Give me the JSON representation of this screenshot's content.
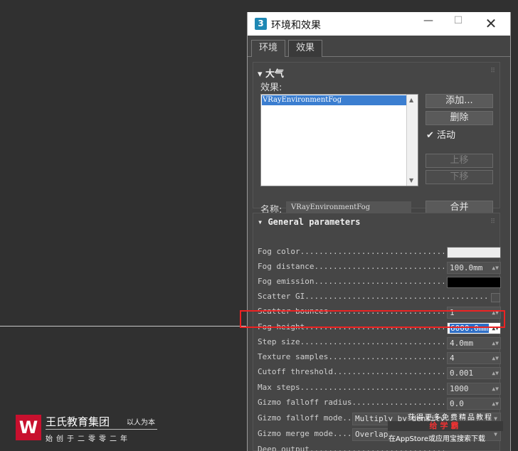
{
  "window": {
    "icon_label": "3",
    "title": "环境和效果",
    "minimize": "—",
    "maximize": "☐",
    "close": "✕"
  },
  "tabs": [
    {
      "label": "环境",
      "active": true
    },
    {
      "label": "效果",
      "active": false
    }
  ],
  "atmosphere": {
    "header": "▾ 大气",
    "effects_label": "效果:",
    "effects_list": [
      "VRayEnvironmentFog"
    ],
    "buttons": {
      "add": "添加...",
      "delete": "删除",
      "active": "活动",
      "move_up": "上移",
      "move_down": "下移",
      "merge": "合并"
    },
    "active_checked": true,
    "name_label": "名称:",
    "name_value": "VRayEnvironmentFog"
  },
  "general": {
    "header": "▾ General parameters",
    "params": [
      {
        "label": "Fog color.....................................",
        "type": "color",
        "color": "#ececec"
      },
      {
        "label": "Fog distance..................................",
        "type": "spin",
        "value": "100.0mm"
      },
      {
        "label": "Fog emission..................................",
        "type": "color",
        "color": "#000000"
      },
      {
        "label": "Scatter GI.............................................",
        "type": "check"
      },
      {
        "label": "Scatter bounces...............................",
        "type": "spin",
        "value": "1"
      },
      {
        "label": "Fog height....................................",
        "type": "spin",
        "value": "6000.0mm",
        "active": true
      },
      {
        "label": "Step size.....................................",
        "type": "spin",
        "value": "4.0mm"
      },
      {
        "label": "Texture samples...............................",
        "type": "spin",
        "value": "4"
      },
      {
        "label": "Cutoff threshold..............................",
        "type": "spin",
        "value": "0.001"
      },
      {
        "label": "Max steps.....................................",
        "type": "spin",
        "value": "1000"
      },
      {
        "label": "Gizmo falloff radius..........................",
        "type": "spin",
        "value": "0.0"
      },
      {
        "label": "Gizmo falloff mode....",
        "type": "dropdown",
        "value": "Multiply by density"
      },
      {
        "label": "Gizmo merge mode......",
        "type": "dropdown",
        "value": "Overlap"
      },
      {
        "label": "Deep output...................................",
        "type": "none"
      }
    ]
  },
  "branding": {
    "logo_letter": "W",
    "company": "王氏教育集团",
    "slogan": "以人为本",
    "tagline": "始创于二零零二年"
  },
  "watermark": {
    "line1": "获得更多免费精品教程",
    "line2": "给学霸",
    "line3": "在AppStore或应用宝搜索下载"
  },
  "colors": {
    "accent": "#3b7ed0",
    "highlight_box": "#ee2222",
    "brand_red": "#c8102e"
  }
}
